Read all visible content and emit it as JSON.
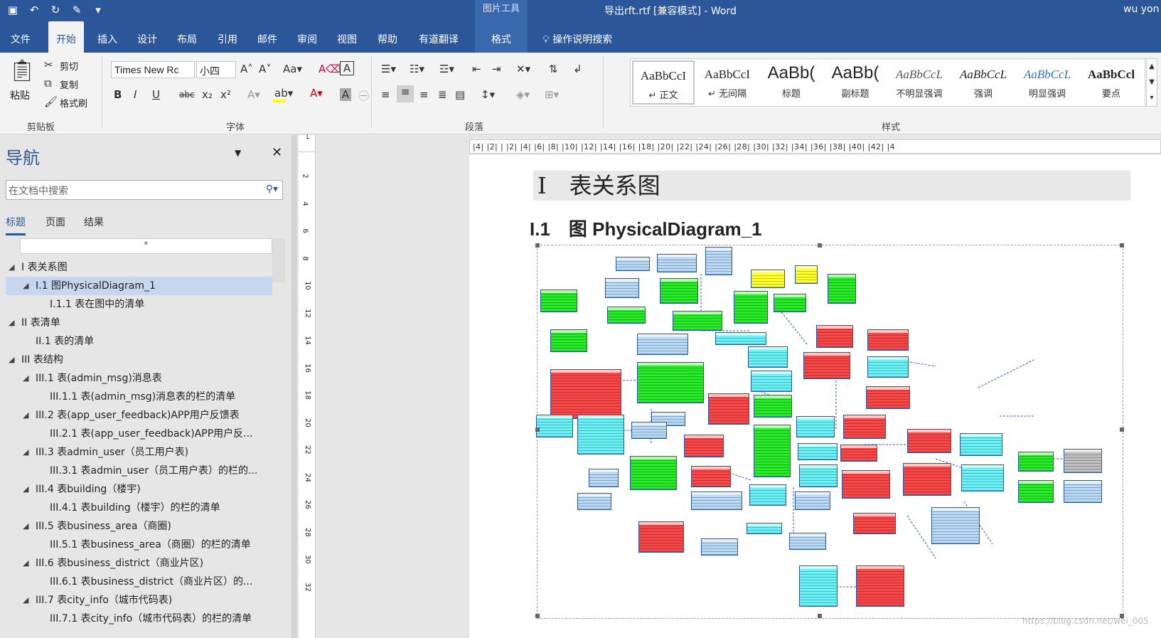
{
  "window": {
    "title": "导出rft.rtf [兼容模式] - Word",
    "picture_tools": "图片工具",
    "user": "wu yon"
  },
  "qat": [
    "save-icon",
    "undo-icon",
    "redo-icon",
    "edit-icon",
    "customize-icon"
  ],
  "tabs": [
    {
      "label": "文件"
    },
    {
      "label": "开始"
    },
    {
      "label": "插入"
    },
    {
      "label": "设计"
    },
    {
      "label": "布局"
    },
    {
      "label": "引用"
    },
    {
      "label": "邮件"
    },
    {
      "label": "审阅"
    },
    {
      "label": "视图"
    },
    {
      "label": "帮助"
    },
    {
      "label": "有道翻译"
    },
    {
      "label": "格式"
    }
  ],
  "tell_me": "操作说明搜索",
  "clipboard": {
    "paste": "粘贴",
    "cut": "剪切",
    "copy": "复制",
    "format_painter": "格式刷",
    "label": "剪贴板"
  },
  "font": {
    "name": "Times New Rc",
    "size": "小四",
    "label": "字体",
    "buttons": [
      "B",
      "I",
      "U",
      "abc",
      "x₂",
      "x²"
    ]
  },
  "paragraph": {
    "label": "段落"
  },
  "styles": {
    "label": "样式",
    "items": [
      {
        "sample": "AaBbCcI",
        "name": "↵ 正文"
      },
      {
        "sample": "AaBbCcI",
        "name": "↵ 无间隔"
      },
      {
        "sample": "AaBb(",
        "name": "标题"
      },
      {
        "sample": "AaBb(",
        "name": "副标题"
      },
      {
        "sample": "AaBbCcL",
        "name": "不明显强调"
      },
      {
        "sample": "AaBbCcL",
        "name": "强调"
      },
      {
        "sample": "AaBbCcL",
        "name": "明显强调"
      },
      {
        "sample": "AaBbCcl",
        "name": "要点"
      }
    ]
  },
  "nav": {
    "title": "导航",
    "search_placeholder": "在文档中搜索",
    "tabs": [
      "标题",
      "页面",
      "结果"
    ],
    "items": [
      {
        "label": "I 表关系图",
        "level": 0,
        "expanded": true
      },
      {
        "label": "I.1 图PhysicalDiagram_1",
        "level": 1,
        "expanded": true,
        "selected": true
      },
      {
        "label": "I.1.1 表在图中的清单",
        "level": 2
      },
      {
        "label": "II 表清单",
        "level": 0,
        "expanded": true
      },
      {
        "label": "II.1 表的清单",
        "level": 1
      },
      {
        "label": "III 表结构",
        "level": 0,
        "expanded": true
      },
      {
        "label": "III.1 表(admin_msg)消息表",
        "level": 1,
        "expanded": true
      },
      {
        "label": "III.1.1 表(admin_msg)消息表的栏的清单",
        "level": 2
      },
      {
        "label": "III.2 表(app_user_feedback)APP用户反馈表",
        "level": 1,
        "expanded": true
      },
      {
        "label": "III.2.1 表(app_user_feedback)APP用户反...",
        "level": 2
      },
      {
        "label": "III.3 表admin_user（员工用户表)",
        "level": 1,
        "expanded": true
      },
      {
        "label": "III.3.1 表admin_user（员工用户表）的栏的...",
        "level": 2
      },
      {
        "label": "III.4 表building（楼宇)",
        "level": 1,
        "expanded": true
      },
      {
        "label": "III.4.1 表building（楼宇）的栏的清单",
        "level": 2
      },
      {
        "label": "III.5 表business_area（商圈)",
        "level": 1,
        "expanded": true
      },
      {
        "label": "III.5.1 表business_area（商圈）的栏的清单",
        "level": 2
      },
      {
        "label": "III.6 表business_district（商业片区)",
        "level": 1,
        "expanded": true
      },
      {
        "label": "III.6.1 表business_district（商业片区）的...",
        "level": 2
      },
      {
        "label": "III.7 表city_info（城市代码表)",
        "level": 1,
        "expanded": true
      },
      {
        "label": "III.7.1 表city_info（城市代码表）的栏的清单",
        "level": 2
      }
    ]
  },
  "doc": {
    "heading1": "I　表关系图",
    "heading2": "I.1　图 PhysicalDiagram_1",
    "ruler": "|4| |2| | |2| |4| |6| |8| |10| |12| |14| |16| |18| |20| |22| |24| |26| |28| |30| |32| |34| |36| |38| |40| |42| |4",
    "vruler": [
      "2",
      "4",
      "6",
      "8",
      "10",
      "12",
      "14",
      "16",
      "18",
      "20",
      "22",
      "24",
      "26",
      "28",
      "30",
      "32"
    ]
  },
  "watermark": "https://blog.csdn.net/wei_005",
  "colors": {
    "accent": "#2b579a",
    "green": "#2fe62f",
    "red": "#f24a4a",
    "cyan": "#6ef0f5",
    "blue": "#b9d9f5",
    "yellow": "#ffff33"
  }
}
